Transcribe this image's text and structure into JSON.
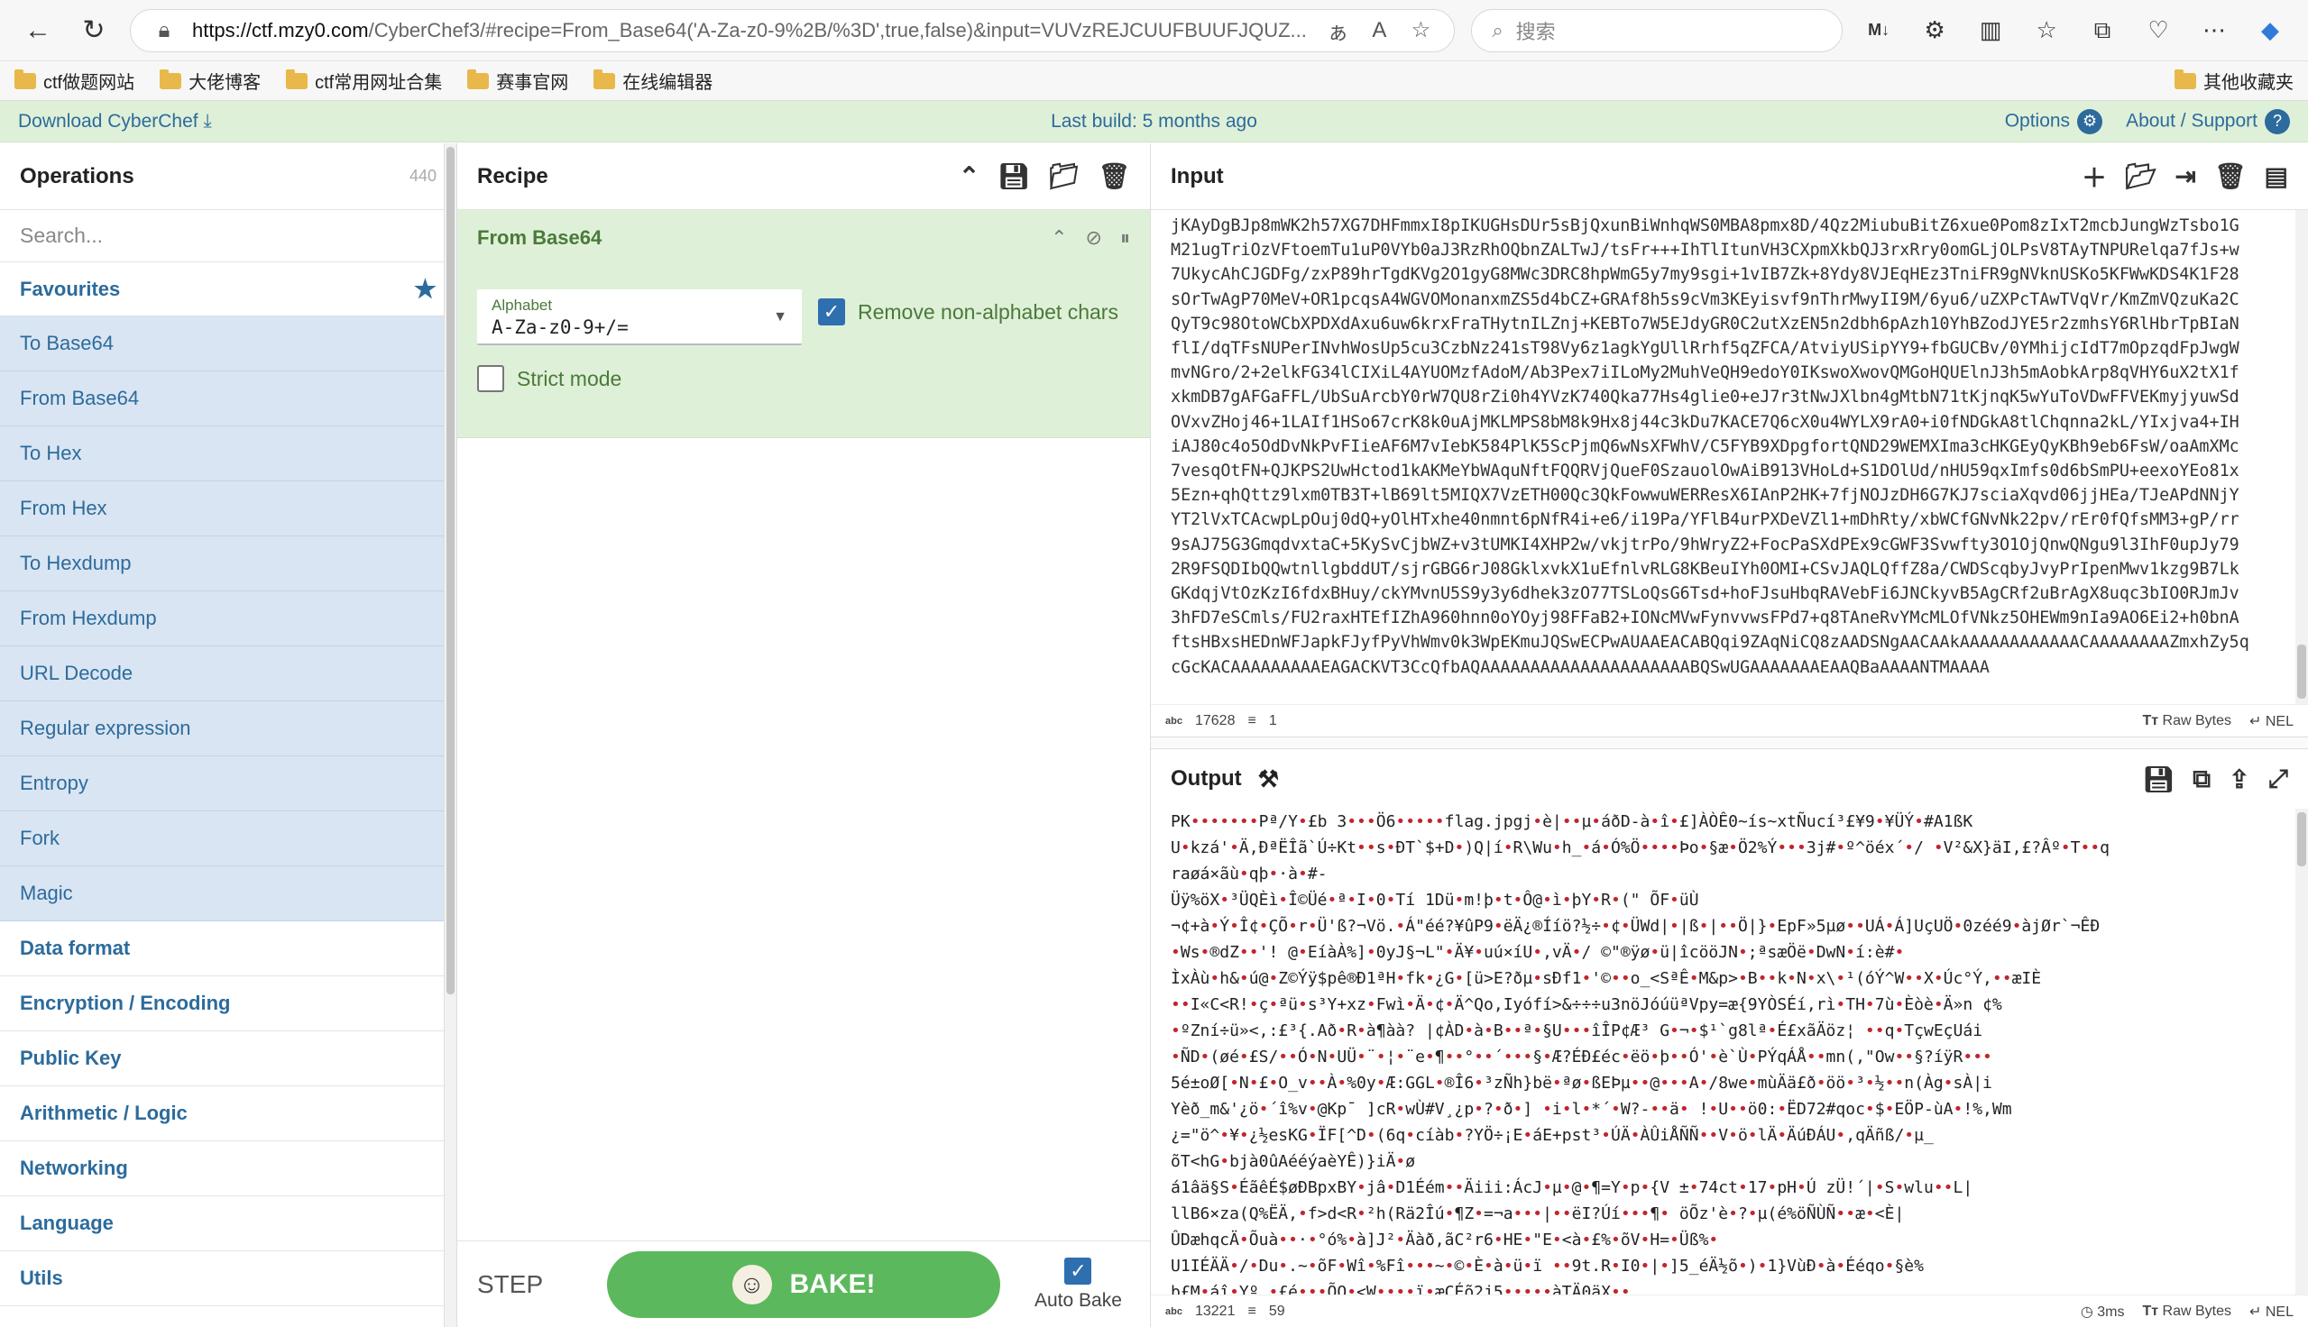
{
  "browser": {
    "url_host": "https://ctf.mzy0.com",
    "url_rest": "/CyberChef3/#recipe=From_Base64('A-Za-z0-9%2B/%3D',true,false)&input=VUVzREJCUUFBUUFJQUZ...",
    "search_placeholder": "搜索",
    "bookmarks": [
      "ctf做题网站",
      "大佬博客",
      "ctf常用网址合集",
      "赛事官网",
      "在线编辑器"
    ],
    "other_bookmarks": "其他收藏夹"
  },
  "banner": {
    "download": "Download CyberChef",
    "last_build": "Last build: 5 months ago",
    "options": "Options",
    "about": "About / Support"
  },
  "operations": {
    "title": "Operations",
    "count": "440",
    "search_placeholder": "Search...",
    "favourites_label": "Favourites",
    "favourites": [
      "To Base64",
      "From Base64",
      "To Hex",
      "From Hex",
      "To Hexdump",
      "From Hexdump",
      "URL Decode",
      "Regular expression",
      "Entropy",
      "Fork",
      "Magic"
    ],
    "categories": [
      "Data format",
      "Encryption / Encoding",
      "Public Key",
      "Arithmetic / Logic",
      "Networking",
      "Language",
      "Utils"
    ]
  },
  "recipe": {
    "title": "Recipe",
    "operation": {
      "title": "From Base64",
      "alphabet_label": "Alphabet",
      "alphabet_value": "A-Za-z0-9+/=",
      "remove_label": "Remove non-alphabet chars",
      "remove_checked": true,
      "strict_label": "Strict mode",
      "strict_checked": false
    },
    "step": "STEP",
    "bake": "BAKE!",
    "autobake": "Auto Bake",
    "autobake_checked": true
  },
  "input": {
    "title": "Input",
    "text": "jKAyDgBJp8mWK2h57XG7DHFmmxI8pIKUGHsDUr5sBjQxunBiWnhqWS0MBA8pmx8D/4Qz2MiubuBitZ6xue0Pom8zIxT2mcbJungWzTsbo1G\nM21ugTriOzVFtoemTu1uP0VYb0aJ3RzRhOQbnZALTwJ/tsFr+++IhTlItunVH3CXpmXkbQJ3rxRry0omGLjOLPsV8TAyTNPURelqa7fJs+w\n7UkycAhCJGDFg/zxP89hrTgdKVg2O1gyG8MWc3DRC8hpWmG5y7my9sgi+1vIB7Zk+8Ydy8VJEqHEz3TniFR9gNVknUSKo5KFWwKDS4K1F28\nsOrTwAgP70MeV+OR1pcqsA4WGVOMonanxmZS5d4bCZ+GRAf8h5s9cVm3KEyisvf9nThrMwyII9M/6yu6/uZXPcTAwTVqVr/KmZmVQzuKa2C\nQyT9c98OtoWCbXPDXdAxu6uw6krxFraTHytnILZnj+KEBTo7W5EJdyGR0C2utXzEN5n2dbh6pAzh10YhBZodJYE5r2zmhsY6RlHbrTpBIaN\nflI/dqTFsNUPerINvhWosUp5cu3CzbNz241sT98Vy6z1agkYgUllRrhf5qZFCA/AtviyUSipYY9+fbGUCBv/0YMhijcIdT7mOpzqdFpJwgW\nmvNGro/2+2elkFG34lCIXiL4AYUOMzfAdoM/Ab3Pex7iILoMy2MuhVeQH9edoY0IKswoXwovQMGoHQUElnJ3h5mAobkArp8qVHY6uX2tX1f\nxkmDB7gAFGaFFL/UbSuArcbY0rW7QU8rZi0h4YVzK740Qka77Hs4glie0+eJ7r3tNwJXlbn4gMtbN71tKjnqK5wYuToVDwFFVEKmyjyuwSd\nOVxvZHoj46+1LAIf1HSo67crK8k0uAjMKLMPS8bM8k9Hx8j44c3kDu7KACE7Q6cX0u4WYLX9rA0+i0fNDGkA8tlChqnna2kL/YIxjva4+IH\niAJ80c4o5OdDvNkPvFIieAF6M7vIebK584PlK5ScPjmQ6wNsXFWhV/C5FYB9XDpgfortQND29WEMXIma3cHKGEyQyKBh9eb6FsW/oaAmXMc\n7vesqOtFN+QJKPS2UwHctod1kAKMeYbWAquNftFQQRVjQueF0SzauolOwAiB913VHoLd+S1DOlUd/nHU59qxImfs0d6bSmPU+eexoYEo81x\n5Ezn+qhQttz9lxm0TB3T+lB69lt5MIQX7VzETH00Qc3QkFowwuWERResX6IAnP2HK+7fjNOJzDH6G7KJ7sciaXqvd06jjHEa/TJeAPdNNjY\nYT2lVxTCAcwpLpOuj0dQ+yOlHTxhe40nmnt6pNfR4i+e6/i19Pa/YFlB4urPXDeVZl1+mDhRty/xbWCfGNvNk22pv/rEr0fQfsMM3+gP/rr\n9sAJ75G3GmqdvxtaC+5KySvCjbWZ+v3tUMKI4XHP2w/vkjtrPo/9hWryZ2+FocPaSXdPEx9cGWF3Svwfty3O1OjQnwQNgu9l3IhF0upJy79\n2R9FSQDIbQQwtnllgbddUT/sjrGBG6rJ08GklxvkX1uEfnlvRLG8KBeuIYh0OMI+CSvJAQLQffZ8a/CWDScqbyJvyPrIpenMwv1kzg9B7Lk\nGKdqjVtOzKzI6fdxBHuy/ckYMvnU5S9y3y6dhek3zO77TSLoQsG6Tsd+hoFJsuHbqRAVebFi6JNCkyvB5AgCRf2uBrAgX8uqc3bIO0RJmJv\n3hFD7eSCmls/FU2raxHTEfIZhA960hnn0oYOyj98FFaB2+IONcMVwFynvvwsFPd7+q8TAneRvYMcMLOfVNkz5OHEWm9nIa9AO6Ei2+h0bnA\nftsHBxsHEDnWFJapkFJyfPyVhWmv0k3WpEKmuJQSwECPwAUAAEACABQqi9ZAqNiCQ8zAADSNgAACAAkAAAAAAAAAAAACAAAAAAAAZmxhZy5q\ncGcKACAAAAAAAAAEAGACKVT3CcQfbAQAAAAAAAAAAAAAAAAAAAAABQSwUGAAAAAAAEAAQBaAAAANTMAAAA",
    "length": "17628",
    "lines": "1",
    "format": "Raw Bytes",
    "eol": "NEL"
  },
  "output": {
    "title": "Output",
    "length": "13221",
    "lines": "59",
    "time": "3ms",
    "format": "Raw Bytes",
    "eol": "NEL",
    "lines_text": [
      "PK•••••••Pª/Y•£b    3•••Ö6•••••flag.jpgj•è|••µ•áðD-à•î•£]ÀÒÊ0~ís~xtÑucí³£¥9•¥ÜÝ•#A1ßK",
      "U•kzá'•Ä,ÐªËÎã`Ú÷Kt••s•ÐT`$+D•)Q|í•R\\Wu•h_•á•Ó%Ö••••Þo•§æ•Ö2%Ý•••3j#•º^öéx´•/  •V²&X}äI,£?Âº•T••q",
      "raøá×ãù•qþ•·à•#-",
      "Üÿ%öX•³ÜQÈì•Î©Üé•ª•I•0•Tí 1Dü•m!þ•t•Ô@•ì•þY•R•(\" ÕF•üÙ",
      "¬¢+à•Ý•Î¢•ÇÕ•r•Ü'ß?¬Vö.•Á\"éé?¥ûP9•ëÄ¿®Ííö?½÷•¢•ÜWd|•|ß•|••Ö|}•EpF»5µø••UÁ•Á]UçUÖ•0zéé9•àjØr`¬ÊÐ",
      "•Ws•®dZ••'!  @•EíàÀ%]•0yJ§¬L\"•Ä¥•uú×íU•,vÄ•/ ©\"®ÿø•ü|îcööJN•;ªsæÖë•DwN•í:è#•",
      "ÌxÀù•h&•ú@•Z©Ýÿ$pê®Ð1ªH•fk•¿G•[ü>E?ðµ•sÐf1•'©••o_<SªÊ•M&p>•B••k•N•x\\•¹(óÝ^W••X•Úc°Ý,••æIÈ",
      "••I«C<R!•ç•ªü•s³Y+xz•Fwì•Ä•¢•Ä^Qo,Iyófí>&÷÷÷u3nöJóúüªVpy=æ{9YÒSÉí,rì•TH•7ù•Èòè•Ä»n ¢%",
      "•ºZní÷ü»<,:£³{.Að•R•à¶àà?  |¢ÀD•à•B••ª•§U•••îÎP¢Æ³ G•¬•$¹`g8lª•É£xãÄöz¦  ••q•TçwEçUái",
      "•ÑD•(øé•£S/••Ó•N•UÜ•¨•¦•¨e•¶••°••´•••§•Æ?ÉÐ£éc•ëö•þ••Ó'•è`Ù•PÝqÁÅ••mn(,\"Ow••§?íÿR•••",
      "5é±oØ[•N•£•O_v••À•%0y•Æ:GGL•®Î6•³zÑh}bë•ªø•ßEÞµ••@•••A•/8we•mùÄä£ð•öö•³•½••n(Àg•sÀ|i",
      "Yèð_m&'¿ö•´î%v•@Kp¯  ]cR•wÙ#V¸¿p•?•ð•]  •i•l•*´•W?-••ä• !•U••ö0:•ËD72#qoc•$•EÖP-ùA•!%,Wm",
      "¿=\"ö^•¥•¿½esKG•ÏF[^D•(6q•cíàb•?YÖ÷¡E•áE+pst³•ÚÄ•ÀÛiÅÑÑ••V•ö•lÄ•ÄúÐÁU•,qÄñß/•µ_",
      "õT<hG•bjà0ûAééýaèYÊ)}iÄ•ø",
      "á1âä§S•ÉãêÉ$øÐBpxBY•jâ•D1Éém••Äiii:ÁcJ•µ•@•¶=Y•p•{V ±•74ct•17•pH•Ú zÜ!´|•S•wlu••L|",
      "llB6×za(Q%ËÄ,•f>d<R•²h(Rä2Îú•¶Z•=¬a•••|••ëI?Úí•••¶• öÕz'è•?•µ(é%öÑÙÑ••æ•<È|",
      "ÛDæhqcÄ•Õuà••·•°ó%•à]J²•Äàð,ãC²r6•HE•\"E•<à•£%•õV•H=•Üß%•",
      "U1IÉÄÄ•/•Du•.~•õF•Wî•%Fî•••~•©•È•à•ü•ï ••9t.R•I0•|•]5_éÄ½õ•)•1}VùÐ•à•Ééqo•§è%",
      "b£M•áî•Yº  •£é•••ÕQ•<W••••ï•æCÉõ2j5•••••àTÄ0äX••"
    ]
  }
}
